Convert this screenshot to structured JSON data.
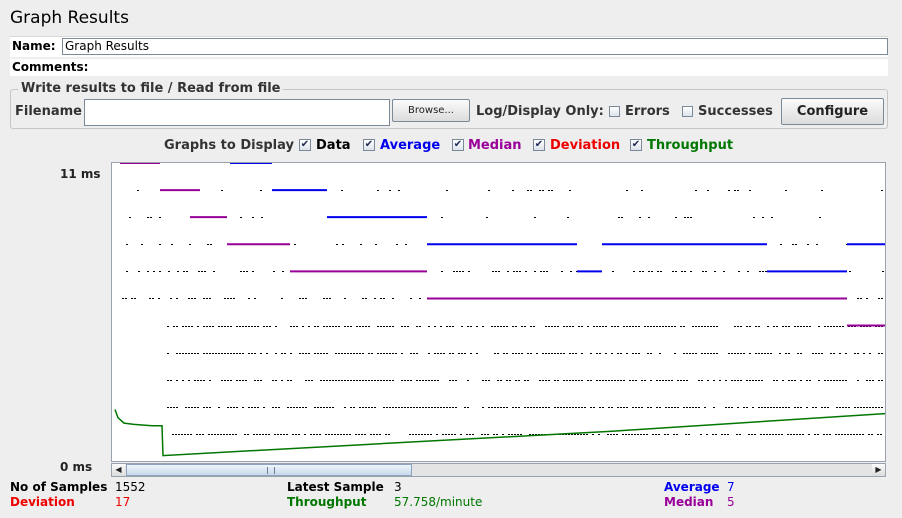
{
  "title": "Graph Results",
  "name_label": "Name:",
  "name_value": "Graph Results",
  "comments_label": "Comments:",
  "file_panel": {
    "legend": "Write results to file / Read from file",
    "filename_label": "Filename",
    "filename_value": "",
    "browse_label": "Browse...",
    "log_display_label": "Log/Display Only:",
    "errors_label": "Errors",
    "successes_label": "Successes",
    "errors_checked": false,
    "successes_checked": false,
    "configure_label": "Configure"
  },
  "graphs_to_display": {
    "label": "Graphs to Display",
    "items": [
      {
        "label": "Data",
        "checked": true,
        "color": "#000000"
      },
      {
        "label": "Average",
        "checked": true,
        "color": "#0000ee"
      },
      {
        "label": "Median",
        "checked": true,
        "color": "#990099"
      },
      {
        "label": "Deviation",
        "checked": true,
        "color": "#ee0000"
      },
      {
        "label": "Throughput",
        "checked": true,
        "color": "#007700"
      }
    ]
  },
  "axis": {
    "top_label": "11 ms",
    "bottom_label": "0 ms"
  },
  "chart_data": {
    "type": "scatter",
    "ylim": [
      0,
      11
    ],
    "y_unit": "ms",
    "data_levels_ms": [
      1,
      2,
      3,
      4,
      5,
      6,
      7,
      8,
      9,
      10
    ],
    "series": [
      {
        "name": "Data",
        "color": "#000000"
      },
      {
        "name": "Average",
        "color": "#0000ee",
        "final_value": 7
      },
      {
        "name": "Median",
        "color": "#990099",
        "final_value": 5
      },
      {
        "name": "Throughput",
        "color": "#007700",
        "final_value": "57.758/minute"
      }
    ]
  },
  "stats": {
    "samples_label": "No of Samples",
    "samples_value": "1552",
    "latest_label": "Latest Sample",
    "latest_value": "3",
    "average_label": "Average",
    "average_value": "7",
    "deviation_label": "Deviation",
    "deviation_value": "17",
    "throughput_label": "Throughput",
    "throughput_value": "57.758/minute",
    "median_label": "Median",
    "median_value": "5"
  }
}
